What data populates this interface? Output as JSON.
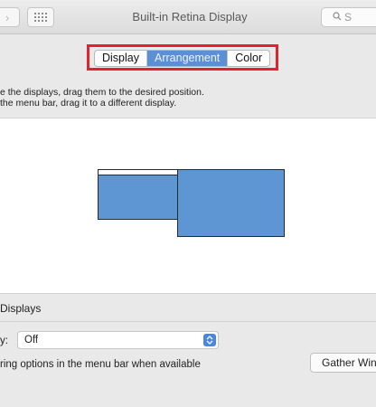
{
  "window": {
    "title": "Built-in Retina Display",
    "search_placeholder": "S",
    "forward_glyph": "›"
  },
  "tabs": [
    {
      "label": "Display",
      "active": false
    },
    {
      "label": "Arrangement",
      "active": true
    },
    {
      "label": "Color",
      "active": false
    }
  ],
  "instructions": {
    "line1": "e the displays, drag them to the desired position.",
    "line2": " the menu bar, drag it to a different display."
  },
  "mirror": {
    "label": "Displays"
  },
  "airplay": {
    "label": "y:",
    "value": "Off"
  },
  "mirroring_options": {
    "label": "ring options in the menu bar when available"
  },
  "gather_button": {
    "label": "Gather Win"
  },
  "colors": {
    "accent": "#5b8fd6",
    "display_fill": "#5e95d3",
    "highlight": "#e2232b"
  }
}
